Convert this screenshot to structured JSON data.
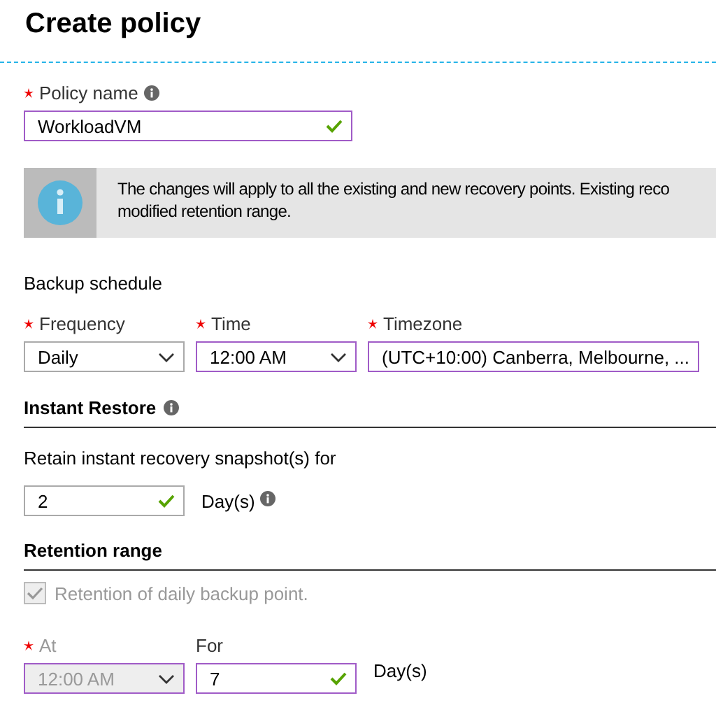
{
  "title": "Create policy",
  "policy_name": {
    "label": "Policy name",
    "required": true,
    "info": true,
    "value": "WorkloadVM",
    "highlighted": true,
    "valid": true
  },
  "notice": {
    "lines": [
      "The changes will apply to all the existing and new recovery points. Existing reco",
      "modified retention range."
    ]
  },
  "backup_schedule": {
    "heading": "Backup schedule",
    "fields": [
      {
        "label": "Frequency",
        "required": true,
        "value": "Daily",
        "highlighted": false,
        "disabled": false
      },
      {
        "label": "Time",
        "required": true,
        "value": "12:00 AM",
        "highlighted": true,
        "disabled": false
      },
      {
        "label": "Timezone",
        "required": true,
        "value": "(UTC+10:00) Canberra, Melbourne, ...",
        "highlighted": true,
        "disabled": false
      }
    ]
  },
  "instant_restore": {
    "heading": "Instant Restore",
    "info": true,
    "prompt": "Retain instant recovery snapshot(s) for",
    "value": "2",
    "highlighted": false,
    "valid": true,
    "unit": "Day(s)",
    "unit_info": true
  },
  "retention_range": {
    "heading": "Retention range",
    "checkbox": {
      "label": "Retention of daily backup point.",
      "checked": true,
      "disabled": true
    },
    "at": {
      "label": "At",
      "required": true,
      "value": "12:00 AM",
      "highlighted": true,
      "disabled": true
    },
    "for": {
      "label": "For",
      "required": false,
      "value": "7",
      "highlighted": true,
      "valid": true
    },
    "unit": "Day(s)"
  }
}
